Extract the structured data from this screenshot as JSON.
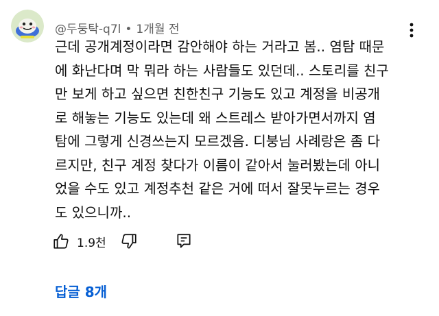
{
  "comment": {
    "author": "@두둥탁-q7l",
    "separator": "•",
    "time": "1개월 전",
    "text_lines": [
      "근데 공개계정이라면 감안해야 하는 거라고 봄.. 염탐 때문",
      "에 화난다며 막 뭐라 하는 사람들도 있던데.. 스토리를 친구",
      "만 보게 하고 싶으면 친한친구 기능도 있고 계정을 비공개",
      "로 해놓는 기능도 있는데 왜 스트레스 받아가면서까지 염",
      "탐에 그렇게 신경쓰는지 모르겠음. 디붕님 사례랑은 좀 다",
      "르지만, 친구 계정 찾다가 이름이 같아서 눌러봤는데 아니",
      "었을 수도 있고 계정추천 같은 거에 떠서 잘못누르는 경우",
      "도 있으니까.."
    ],
    "like_count": "1.9천",
    "replies_label": "답글 8개"
  },
  "icons": {
    "avatar": "avatar-image",
    "more": "more-vertical-icon",
    "like": "thumbs-up-icon",
    "dislike": "thumbs-down-icon",
    "reply": "reply-comment-icon"
  },
  "colors": {
    "text": "#0f0f0f",
    "meta": "#606060",
    "link": "#065fd4"
  }
}
